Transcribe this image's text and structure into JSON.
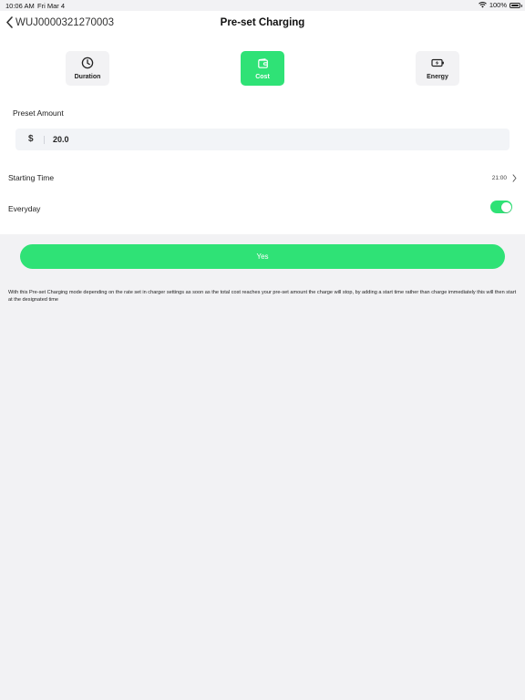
{
  "status": {
    "time": "10:06 AM",
    "date": "Fri Mar 4",
    "battery": "100%"
  },
  "nav": {
    "back_label": "WUJ0000321270003",
    "title": "Pre-set Charging"
  },
  "modes": [
    {
      "label": "Duration",
      "icon": "clock-icon",
      "active": false
    },
    {
      "label": "Cost",
      "icon": "wallet-icon",
      "active": true
    },
    {
      "label": "Energy",
      "icon": "battery-charging-icon",
      "active": false
    }
  ],
  "preset": {
    "label": "Preset Amount",
    "currency": "$",
    "value": "20.0"
  },
  "starting_time": {
    "label": "Starting Time",
    "value": "21:00"
  },
  "everyday": {
    "label": "Everyday",
    "on": true
  },
  "yes_button": "Yes",
  "info_text": "With this Pre-set Charging mode depending on the rate set in charger settings as soon as the total cost reaches your pre-set amount the charge will stop, by adding a start time rather than charge immediately this will then start at the designated time",
  "colors": {
    "accent": "#2fe276",
    "background": "#f2f2f4",
    "card": "#ffffff"
  }
}
